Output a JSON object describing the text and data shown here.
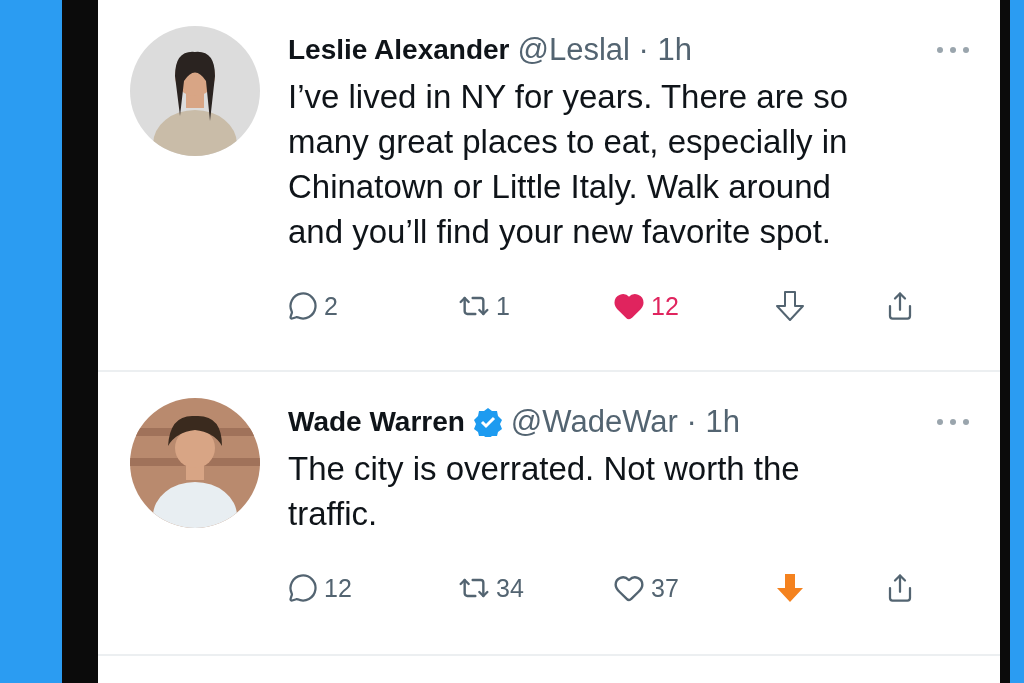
{
  "tweets": [
    {
      "name": "Leslie Alexander",
      "verified": false,
      "handle": "@Leslal",
      "time": "· 1h",
      "text": "I’ve lived in NY for years. There are so many great places to eat, especially in Chinatown or Little Italy. Walk around and you’ll find your new favorite spot.",
      "replies": "2",
      "retweets": "1",
      "likes": "12",
      "liked": true,
      "downvoted": false
    },
    {
      "name": "Wade Warren",
      "verified": true,
      "handle": "@WadeWar",
      "time": "· 1h",
      "text": "The city is overrated. Not worth the traffic.",
      "replies": "12",
      "retweets": "34",
      "likes": "37",
      "liked": false,
      "downvoted": true
    }
  ]
}
